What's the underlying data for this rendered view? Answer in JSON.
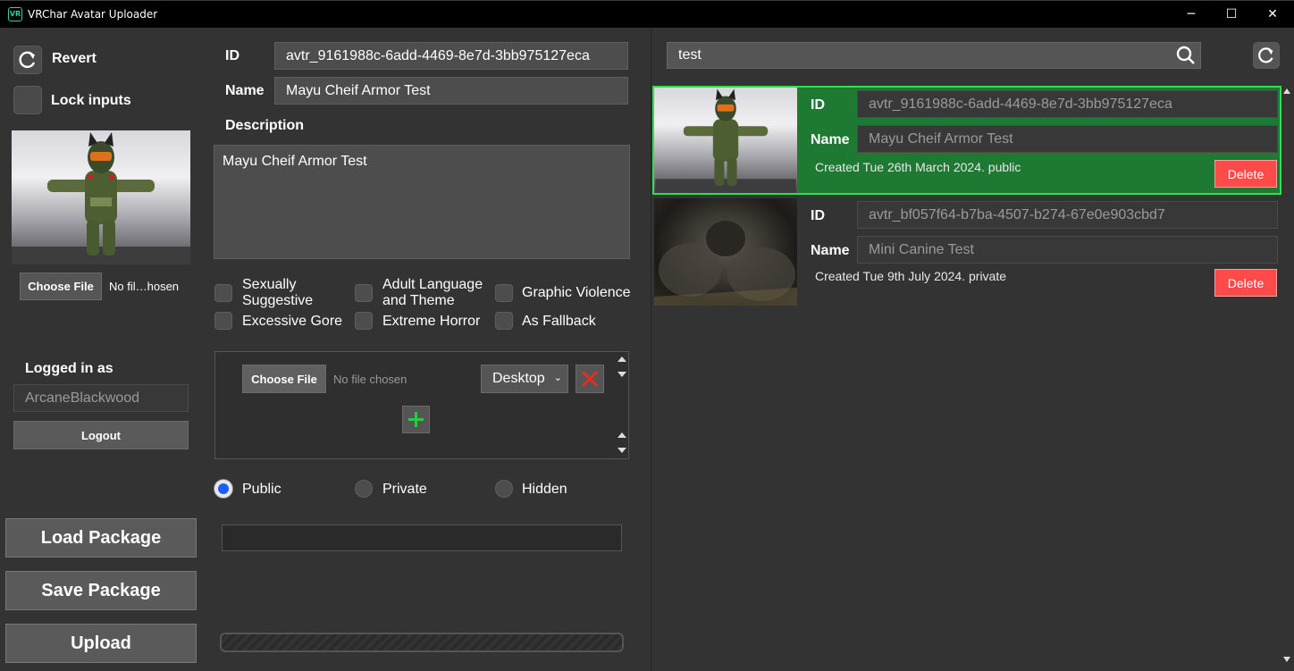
{
  "window": {
    "title": "VRChar Avatar Uploader",
    "app_icon_text": "VR",
    "minimize_glyph": "─",
    "maximize_glyph": "☐",
    "close_glyph": "✕"
  },
  "left": {
    "revert_label": "Revert",
    "lock_inputs_label": "Lock inputs",
    "choose_file_label": "Choose File",
    "image_file_text": "No fil…hosen",
    "logged_in_label": "Logged in as",
    "username": "ArcaneBlackwood",
    "logout_label": "Logout",
    "load_package_label": "Load Package",
    "save_package_label": "Save Package",
    "upload_label": "Upload"
  },
  "form": {
    "id_label": "ID",
    "id_value": "avtr_9161988c-6add-4469-8e7d-3bb975127eca",
    "name_label": "Name",
    "name_value": "Mayu Cheif Armor Test",
    "description_label": "Description",
    "description_value": "Mayu Cheif Armor Test",
    "tags": {
      "sexually_suggestive": "Sexually Suggestive",
      "adult_language": "Adult Language and Theme",
      "graphic_violence": "Graphic Violence",
      "excessive_gore": "Excessive Gore",
      "extreme_horror": "Extreme Horror",
      "as_fallback": "As Fallback"
    },
    "package": {
      "choose_file_label": "Choose File",
      "file_text": "No file chosen",
      "platform_selected": "Desktop",
      "platform_options": [
        "Desktop"
      ]
    },
    "visibility": {
      "public": "Public",
      "private": "Private",
      "hidden": "Hidden",
      "selected": "Public"
    },
    "status_text": ""
  },
  "search": {
    "value": "test",
    "placeholder": ""
  },
  "avatars": [
    {
      "id_label": "ID",
      "id": "avtr_9161988c-6add-4469-8e7d-3bb975127eca",
      "name_label": "Name",
      "name": "Mayu Cheif Armor Test",
      "created": "Created Tue 26th March 2024. public",
      "delete_label": "Delete",
      "selected": true
    },
    {
      "id_label": "ID",
      "id": "avtr_bf057f64-b7ba-4507-b274-67e0e903cbd7",
      "name_label": "Name",
      "name": "Mini Canine Test",
      "created": "Created Tue 9th July 2024. private",
      "delete_label": "Delete",
      "selected": false
    }
  ],
  "colors": {
    "selected_card": "#1e7a33",
    "selected_border": "#2ee050",
    "delete": "#ff4a4a",
    "radio_selected": "#1d5cff",
    "add_plus": "#22cc44",
    "remove_x": "#e03020"
  }
}
